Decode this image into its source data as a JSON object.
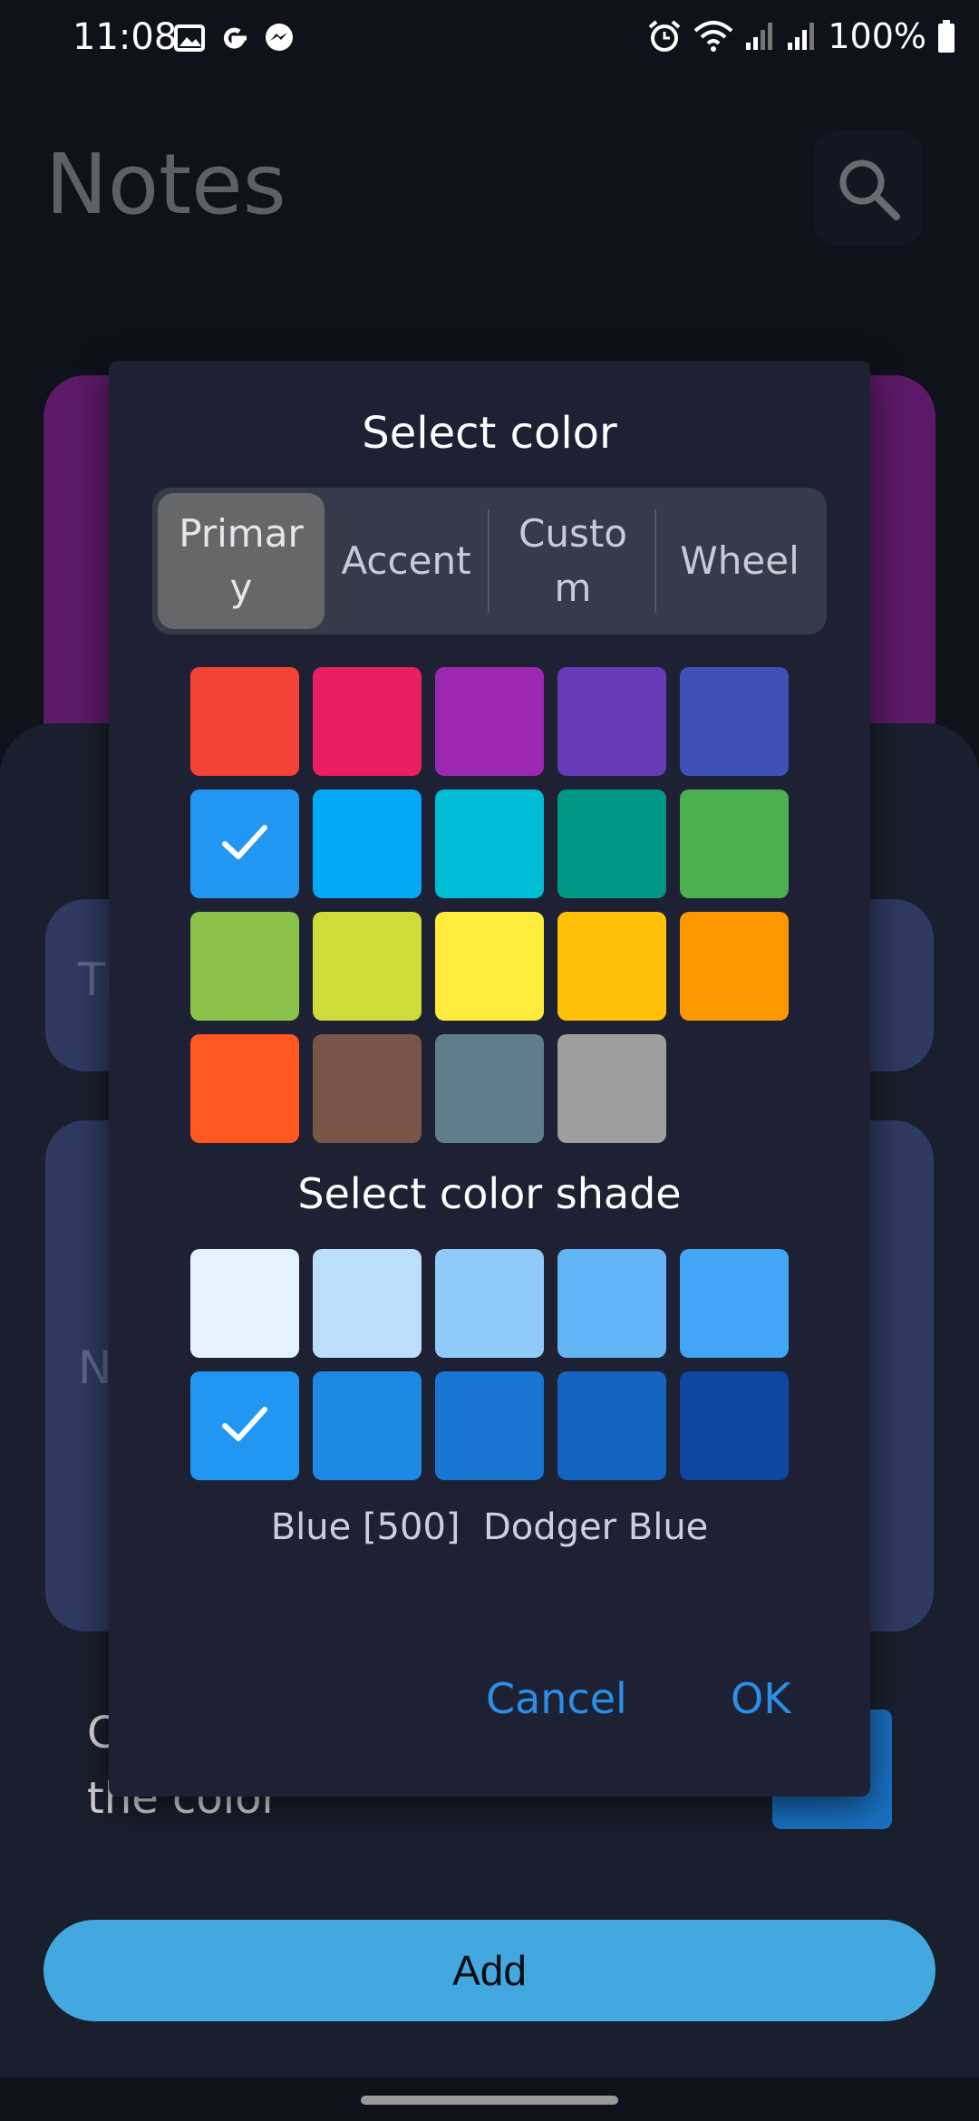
{
  "status_bar": {
    "time": "11:08",
    "battery": "100%"
  },
  "app": {
    "title": "Notes",
    "title_field_placeholder": "Ti",
    "note_field_placeholder": "N",
    "choose_color_text": "C\nthe color",
    "add_button": "Add"
  },
  "dialog": {
    "title": "Select color",
    "tabs": [
      {
        "label": "Primar\ny",
        "active": true
      },
      {
        "label": "Accent",
        "active": false
      },
      {
        "label": "Custo\nm",
        "active": false
      },
      {
        "label": "Wheel",
        "active": false
      }
    ],
    "colors": [
      "#f44336",
      "#e91e63",
      "#9c27b0",
      "#673ab7",
      "#3f51b5",
      "#2196f3",
      "#03a9f4",
      "#00bcd4",
      "#009688",
      "#4caf50",
      "#8bc34a",
      "#cddc39",
      "#ffeb3b",
      "#ffc107",
      "#ff9800",
      "#ff5722",
      "#795548",
      "#607d8b",
      "#9e9e9e"
    ],
    "selected_color_index": 5,
    "shade_title": "Select color shade",
    "shades": [
      "#e3f2fd",
      "#bbdefb",
      "#90caf9",
      "#64b5f6",
      "#42a5f5",
      "#2196f3",
      "#1e88e5",
      "#1976d2",
      "#1565c0",
      "#0d47a1"
    ],
    "selected_shade_index": 5,
    "shade_label": "Blue [500]  Dodger Blue",
    "cancel_label": "Cancel",
    "ok_label": "OK"
  }
}
